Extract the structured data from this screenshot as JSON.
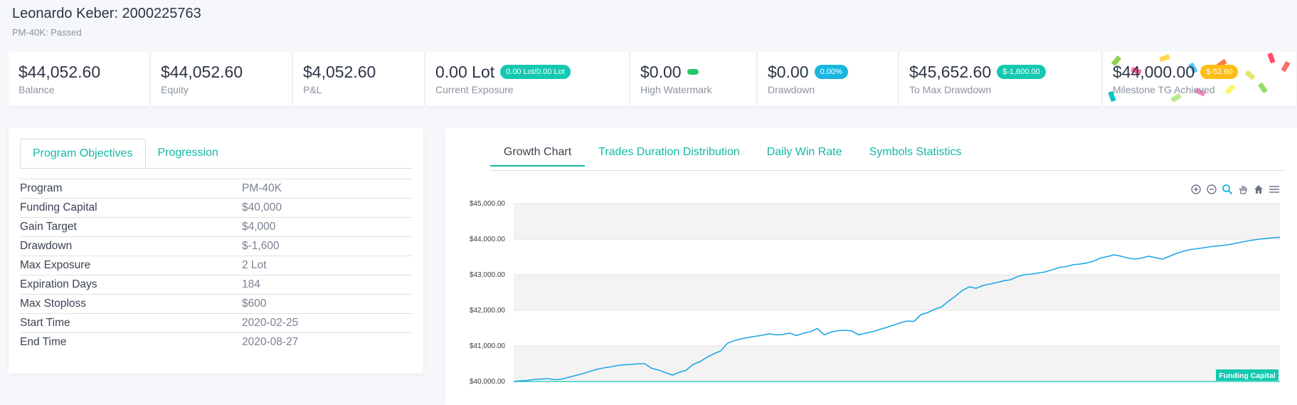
{
  "header": {
    "account_name": "Leonardo Keber: 2000225763",
    "program_status": "PM-40K: Passed"
  },
  "stats": [
    {
      "value": "$44,052.60",
      "label": "Balance"
    },
    {
      "value": "$44,052.60",
      "label": "Equity"
    },
    {
      "value": "$4,052.60",
      "label": "P&L"
    },
    {
      "value": "0.00 Lot",
      "label": "Current Exposure",
      "badge": "0.00 Lot/0.00 Lot"
    },
    {
      "value": "$0.00",
      "label": "High Watermark"
    },
    {
      "value": "$0.00",
      "label": "Drawdown",
      "badge": "0.00%"
    },
    {
      "value": "$45,652.60",
      "label": "To Max Drawdown",
      "badge": "$-1,600.00"
    },
    {
      "value": "$44,000.00",
      "label": "Milestone TG Achieved",
      "badge": "$-52.60"
    }
  ],
  "objectives": {
    "tabs": [
      "Program Objectives",
      "Progression"
    ],
    "rows": [
      {
        "key": "Program",
        "value": "PM-40K"
      },
      {
        "key": "Funding Capital",
        "value": "$40,000"
      },
      {
        "key": "Gain Target",
        "value": "$4,000"
      },
      {
        "key": "Drawdown",
        "value": "$-1,600"
      },
      {
        "key": "Max Exposure",
        "value": "2 Lot"
      },
      {
        "key": "Expiration Days",
        "value": "184"
      },
      {
        "key": "Max Stoploss",
        "value": "$600"
      },
      {
        "key": "Start Time",
        "value": "2020-02-25"
      },
      {
        "key": "End Time",
        "value": "2020-08-27"
      }
    ]
  },
  "chart_tabs": [
    "Growth Chart",
    "Trades Duration Distribution",
    "Daily Win Rate",
    "Symbols Statistics"
  ],
  "toolbar_icons": [
    "zoom-in-icon",
    "zoom-out-icon",
    "selection-zoom-icon",
    "pan-icon",
    "home-icon",
    "menu-icon"
  ],
  "colors": {
    "accent": "#14b8a6",
    "line": "#1ea5e6",
    "funding_line": "#14c8b0"
  },
  "chart_data": {
    "type": "line",
    "ylim": [
      40000,
      45000
    ],
    "yticks": [
      "$45,000.00",
      "$44,000.00",
      "$43,000.00",
      "$42,000.00",
      "$41,000.00",
      "$40,000.00"
    ],
    "annotation": {
      "label": "Funding Capital",
      "y": 40000
    },
    "series": [
      {
        "values": [
          40000,
          40020,
          40030,
          40060,
          40070,
          40080,
          40050,
          40070,
          40120,
          40170,
          40220,
          40280,
          40340,
          40380,
          40410,
          40450,
          40470,
          40480,
          40500,
          40500,
          40370,
          40320,
          40250,
          40180,
          40260,
          40320,
          40480,
          40560,
          40680,
          40780,
          40860,
          41080,
          41150,
          41200,
          41240,
          41270,
          41300,
          41340,
          41310,
          41320,
          41360,
          41290,
          41360,
          41400,
          41490,
          41310,
          41390,
          41430,
          41440,
          41420,
          41310,
          41360,
          41400,
          41460,
          41520,
          41580,
          41650,
          41700,
          41690,
          41880,
          41940,
          42030,
          42100,
          42260,
          42400,
          42560,
          42660,
          42620,
          42700,
          42740,
          42780,
          42830,
          42860,
          42950,
          43000,
          43020,
          43050,
          43080,
          43140,
          43200,
          43230,
          43280,
          43300,
          43330,
          43380,
          43470,
          43510,
          43560,
          43520,
          43470,
          43440,
          43470,
          43520,
          43480,
          43440,
          43520,
          43600,
          43660,
          43710,
          43730,
          43760,
          43790,
          43810,
          43830,
          43860,
          43900,
          43940,
          43970,
          44000,
          44020,
          44040,
          44052
        ]
      }
    ]
  }
}
